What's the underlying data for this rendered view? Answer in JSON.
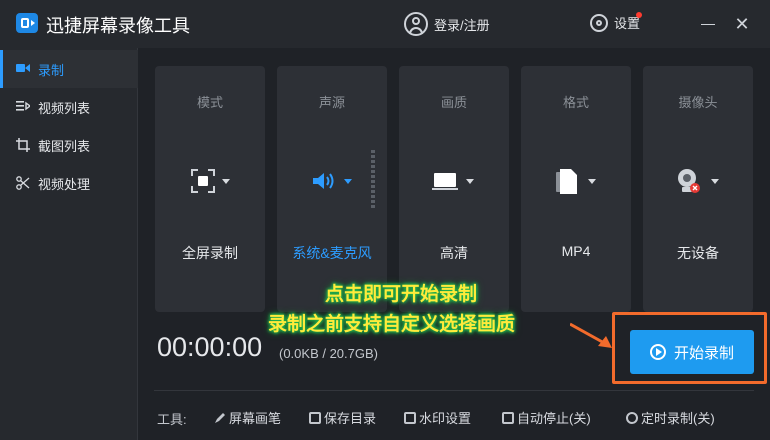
{
  "app": {
    "title": "迅捷屏幕录像工具",
    "user_label": "登录/注册",
    "settings_label": "设置",
    "close_glyph": "✕"
  },
  "sidebar": {
    "items": [
      {
        "label": "录制",
        "icon": "video-camera-icon",
        "active": true
      },
      {
        "label": "视频列表",
        "icon": "video-list-icon",
        "active": false
      },
      {
        "label": "截图列表",
        "icon": "screenshot-list-icon",
        "active": false
      },
      {
        "label": "视频处理",
        "icon": "video-process-icon",
        "active": false
      }
    ]
  },
  "cards": [
    {
      "title": "模式",
      "value": "全屏录制",
      "icon": "fullscreen-icon"
    },
    {
      "title": "声源",
      "value": "系统&麦克风",
      "icon": "speaker-icon",
      "value_color": "#2d9cff"
    },
    {
      "title": "画质",
      "value": "高清",
      "icon": "monitor-icon"
    },
    {
      "title": "格式",
      "value": "MP4",
      "icon": "file-icon"
    },
    {
      "title": "摄像头",
      "value": "无设备",
      "icon": "camera-off-icon"
    }
  ],
  "recording": {
    "timer": "00:00:00",
    "size_info": "(0.0KB / 20.7GB)",
    "start_label": "开始录制"
  },
  "callout": {
    "line1": "点击即可开始录制",
    "line2": "录制之前支持自定义选择画质"
  },
  "tools": {
    "label": "工具:",
    "items": [
      {
        "label": "屏幕画笔",
        "icon": "pen-icon"
      },
      {
        "label": "保存目录",
        "icon": "folder-icon"
      },
      {
        "label": "水印设置",
        "icon": "watermark-icon"
      },
      {
        "label": "自动停止(关)",
        "icon": "pause-icon"
      },
      {
        "label": "定时录制(关)",
        "icon": "clock-icon"
      }
    ]
  },
  "colors": {
    "accent": "#2d9cff",
    "button": "#1e9bf0",
    "highlight_frame": "#f26b2c",
    "callout_text": "#ffeb3b",
    "callout_glow": "#22b14c"
  }
}
